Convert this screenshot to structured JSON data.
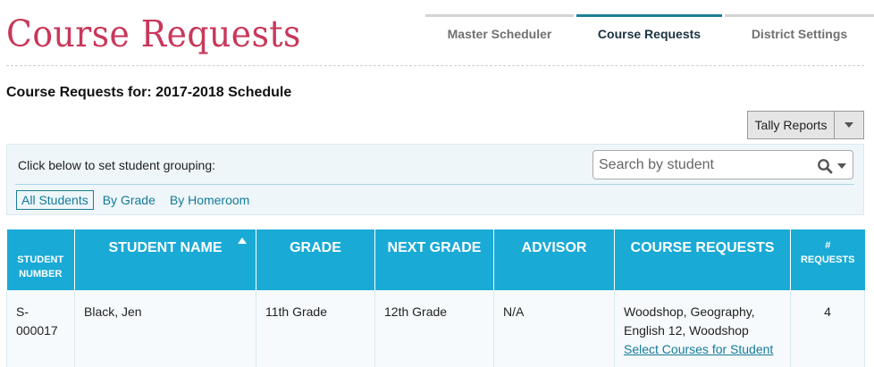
{
  "page": {
    "title": "Course Requests",
    "heading_prefix": "Course Requests for:",
    "heading_schedule": "2017-2018 Schedule"
  },
  "nav": {
    "tabs": [
      {
        "label": "Master Scheduler",
        "active": false
      },
      {
        "label": "Course Requests",
        "active": true
      },
      {
        "label": "District Settings",
        "active": false
      }
    ]
  },
  "tally": {
    "label": "Tally Reports"
  },
  "grouping": {
    "label": "Click below to set student grouping:",
    "options": [
      {
        "label": "All Students",
        "selected": true
      },
      {
        "label": "By Grade",
        "selected": false
      },
      {
        "label": "By Homeroom",
        "selected": false
      }
    ]
  },
  "search": {
    "placeholder": "Search by student",
    "value": ""
  },
  "table": {
    "columns": [
      {
        "line1": "STUDENT",
        "line2": "NUMBER"
      },
      {
        "label": "STUDENT NAME",
        "sorted": "ascending"
      },
      {
        "label": "GRADE"
      },
      {
        "label": "NEXT GRADE"
      },
      {
        "label": "ADVISOR"
      },
      {
        "label": "COURSE REQUESTS"
      },
      {
        "line1": "#",
        "line2": "REQUESTS"
      }
    ],
    "rows": [
      {
        "student_number_line1": "S-",
        "student_number_line2": "000017",
        "student_name": "Black, Jen",
        "grade": "11th Grade",
        "next_grade": "12th Grade",
        "advisor": "N/A",
        "course_requests_line1": "Woodshop, Geography,",
        "course_requests_line2": "English 12, Woodshop",
        "select_link": "Select Courses for Student",
        "request_count": "4"
      }
    ]
  },
  "colors": {
    "title": "#c8385a",
    "header": "#1aaad6",
    "link": "#147a9a",
    "active_tab": "#1b7f95"
  },
  "icons": {
    "search": "magnifier-icon",
    "dropdown": "caret-down-icon",
    "sort": "sort-ascending-icon"
  }
}
